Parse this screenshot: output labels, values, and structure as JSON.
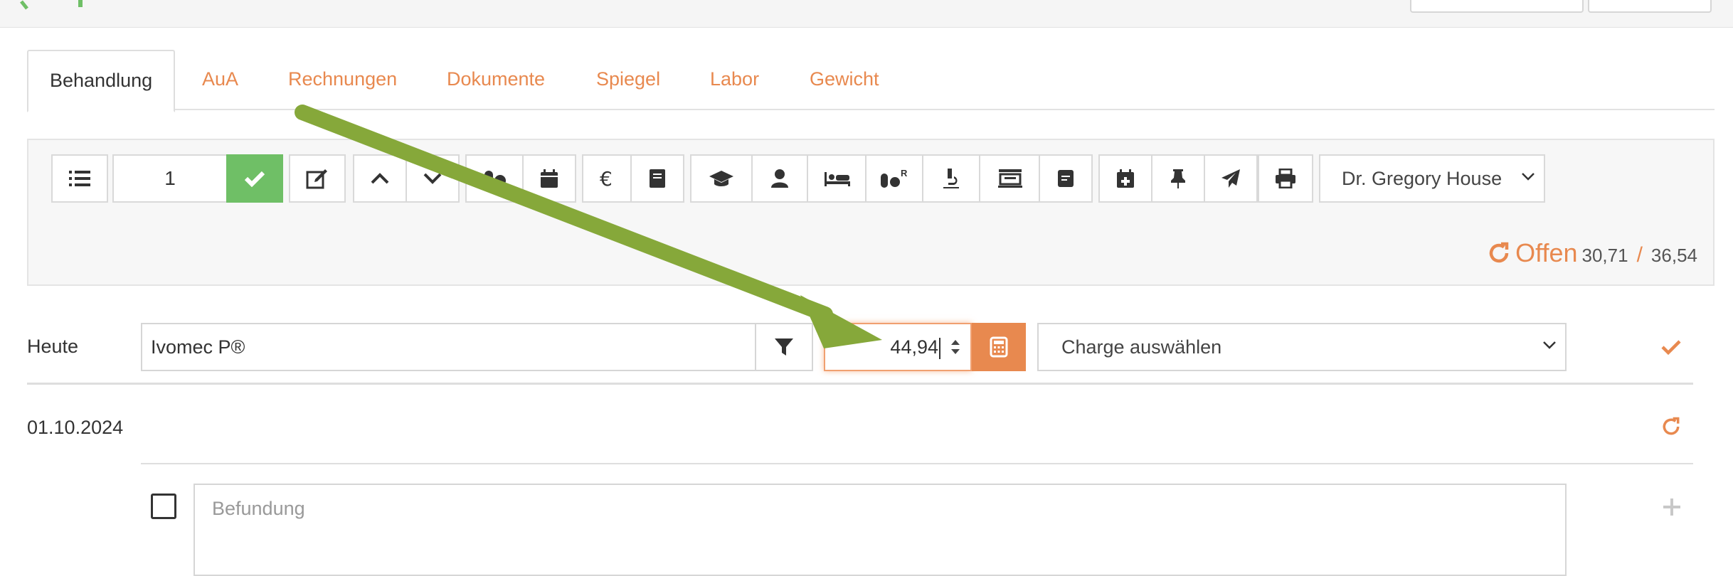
{
  "tabs": [
    {
      "label": "Behandlung",
      "active": true
    },
    {
      "label": "AuA"
    },
    {
      "label": "Rechnungen"
    },
    {
      "label": "Dokumente"
    },
    {
      "label": "Spiegel"
    },
    {
      "label": "Labor"
    },
    {
      "label": "Gewicht"
    }
  ],
  "toolbar": {
    "count_value": "1",
    "doctor": "Dr. Gregory House",
    "icons": [
      "list-icon",
      "check-icon",
      "edit-icon",
      "chevron-up-icon",
      "chevron-down-icon",
      "pills-icon",
      "calendar-icon",
      "euro-icon",
      "book-icon",
      "graduation-cap-icon",
      "user-icon",
      "bed-icon",
      "prescription-pills-icon",
      "microscope-icon",
      "cash-register-icon",
      "receipt-icon",
      "calendar-plus-icon",
      "thumbtack-icon",
      "paper-plane-icon",
      "print-icon"
    ]
  },
  "balance": {
    "label": "Offen",
    "open_amount": "30,71",
    "separator": "/",
    "total_amount": "36,54"
  },
  "entry": {
    "today_label": "Heute",
    "drug": "Ivomec P®",
    "quantity": "44,94",
    "charge_placeholder": "Charge auswählen"
  },
  "history": {
    "date": "01.10.2024",
    "befund_placeholder": "Befundung"
  },
  "colors": {
    "accent": "#e8894f",
    "success": "#6fbf66",
    "arrow": "#86a83a"
  }
}
